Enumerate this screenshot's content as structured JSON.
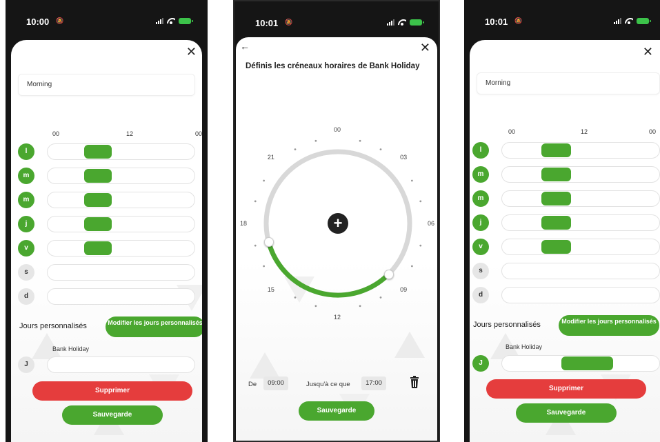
{
  "status": {
    "screen1_time": "10:00",
    "screen2_time": "10:01",
    "screen3_time": "10:01"
  },
  "colors": {
    "green": "#4aa72f",
    "red": "#e53d3d",
    "grey": "#e6e6e6"
  },
  "screen1": {
    "name_value": "Morning",
    "axis": [
      "00",
      "12",
      "00"
    ],
    "days": [
      {
        "label": "l",
        "active": true,
        "slot_start_h": 6,
        "slot_end_h": 10.5
      },
      {
        "label": "m",
        "active": true,
        "slot_start_h": 6,
        "slot_end_h": 10.5
      },
      {
        "label": "m",
        "active": true,
        "slot_start_h": 6,
        "slot_end_h": 10.5
      },
      {
        "label": "j",
        "active": true,
        "slot_start_h": 6,
        "slot_end_h": 10.5
      },
      {
        "label": "v",
        "active": true,
        "slot_start_h": 6,
        "slot_end_h": 10.5
      },
      {
        "label": "s",
        "active": false
      },
      {
        "label": "d",
        "active": false
      }
    ],
    "custom_days_label": "Jours personnalisés",
    "modify_button": "Modifier les jours personnalisés",
    "holiday_name": "Bank Holiday",
    "holiday_day": {
      "label": "J",
      "active": false
    },
    "delete_button": "Supprimer",
    "save_button": "Sauvegarde"
  },
  "screen2": {
    "title": "Définis les créneaux horaires de Bank Holiday",
    "clock_ticks": [
      "00",
      "03",
      "06",
      "09",
      "12",
      "15",
      "18",
      "21"
    ],
    "selected_range_h": [
      9,
      17
    ],
    "from_label": "De",
    "from_value": "09:00",
    "to_label": "Jusqu'à ce que",
    "to_value": "17:00",
    "save_button": "Sauvegarde"
  },
  "screen3": {
    "name_value": "Morning",
    "axis": [
      "00",
      "12",
      "00"
    ],
    "days": [
      {
        "label": "l",
        "active": true,
        "slot_start_h": 6,
        "slot_end_h": 10.5
      },
      {
        "label": "m",
        "active": true,
        "slot_start_h": 6,
        "slot_end_h": 10.5
      },
      {
        "label": "m",
        "active": true,
        "slot_start_h": 6,
        "slot_end_h": 10.5
      },
      {
        "label": "j",
        "active": true,
        "slot_start_h": 6,
        "slot_end_h": 10.5
      },
      {
        "label": "v",
        "active": true,
        "slot_start_h": 6,
        "slot_end_h": 10.5
      },
      {
        "label": "s",
        "active": false
      },
      {
        "label": "d",
        "active": false
      }
    ],
    "custom_days_label": "Jours personnalisés",
    "modify_button": "Modifier les jours personnalisés",
    "holiday_name": "Bank Holiday",
    "holiday_day": {
      "label": "J",
      "active": true,
      "slot_start_h": 9,
      "slot_end_h": 17
    },
    "delete_button": "Supprimer",
    "save_button": "Sauvegarde"
  }
}
